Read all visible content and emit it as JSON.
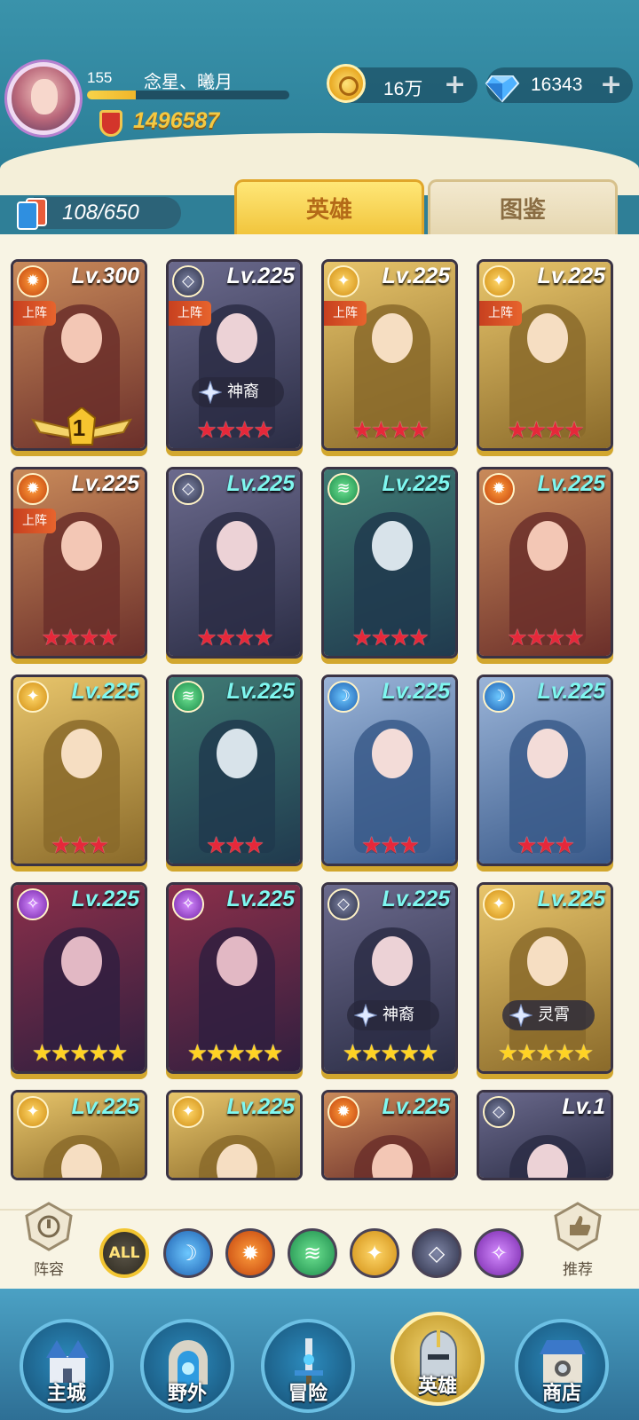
{
  "player": {
    "level": "155",
    "name": "念星、曦月",
    "power": "1496587",
    "exp_fraction": 0.24
  },
  "resources": {
    "gold": "16万",
    "gems": "16343"
  },
  "collection": {
    "count": "108/650"
  },
  "tabs": [
    {
      "label": "英雄",
      "active": true
    },
    {
      "label": "图鉴",
      "active": false
    }
  ],
  "deployed_label": "上阵",
  "heroes": [
    {
      "level": "Lv.300",
      "faction": "fire",
      "deployed": true,
      "stars": 0,
      "star_color": "red",
      "rank": "1"
    },
    {
      "level": "Lv.225",
      "faction": "void",
      "deployed": true,
      "stars": 4,
      "star_color": "red",
      "tag": "神裔"
    },
    {
      "level": "Lv.225",
      "faction": "light",
      "deployed": true,
      "stars": 4,
      "star_color": "red"
    },
    {
      "level": "Lv.225",
      "faction": "light",
      "deployed": true,
      "stars": 4,
      "star_color": "red"
    },
    {
      "level": "Lv.225",
      "faction": "fire",
      "deployed": true,
      "stars": 4,
      "star_color": "red"
    },
    {
      "level": "Lv.225",
      "faction": "void",
      "deployed": false,
      "stars": 4,
      "star_color": "red"
    },
    {
      "level": "Lv.225",
      "faction": "wind",
      "deployed": false,
      "stars": 4,
      "star_color": "red"
    },
    {
      "level": "Lv.225",
      "faction": "fire",
      "deployed": false,
      "stars": 4,
      "star_color": "red"
    },
    {
      "level": "Lv.225",
      "faction": "light",
      "deployed": false,
      "stars": 3,
      "star_color": "red"
    },
    {
      "level": "Lv.225",
      "faction": "wind",
      "deployed": false,
      "stars": 3,
      "star_color": "red"
    },
    {
      "level": "Lv.225",
      "faction": "water",
      "deployed": false,
      "stars": 3,
      "star_color": "red"
    },
    {
      "level": "Lv.225",
      "faction": "water",
      "deployed": false,
      "stars": 3,
      "star_color": "red"
    },
    {
      "level": "Lv.225",
      "faction": "arcane",
      "deployed": false,
      "stars": 5,
      "star_color": "gold"
    },
    {
      "level": "Lv.225",
      "faction": "arcane",
      "deployed": false,
      "stars": 5,
      "star_color": "gold"
    },
    {
      "level": "Lv.225",
      "faction": "void",
      "deployed": false,
      "stars": 5,
      "star_color": "gold",
      "tag": "神裔"
    },
    {
      "level": "Lv.225",
      "faction": "light",
      "deployed": false,
      "stars": 5,
      "star_color": "gold",
      "tag": "灵霄"
    },
    {
      "level": "Lv.225",
      "faction": "light",
      "deployed": false,
      "stars": 0,
      "star_color": "gold"
    },
    {
      "level": "Lv.225",
      "faction": "light",
      "deployed": false,
      "stars": 0,
      "star_color": "gold"
    },
    {
      "level": "Lv.225",
      "faction": "fire",
      "deployed": false,
      "stars": 0,
      "star_color": "gold"
    },
    {
      "level": "Lv.1",
      "faction": "void",
      "deployed": false,
      "stars": 0,
      "star_color": "gold"
    }
  ],
  "filter": {
    "lineup_label": "阵容",
    "recommend_label": "推荐",
    "all_label": "ALL",
    "elements": [
      "water",
      "fire",
      "wind",
      "light",
      "void",
      "arcane"
    ]
  },
  "nav": [
    {
      "label": "主城",
      "icon": "castle-icon"
    },
    {
      "label": "野外",
      "icon": "portal-icon"
    },
    {
      "label": "冒险",
      "icon": "sword-icon"
    },
    {
      "label": "英雄",
      "icon": "helmet-icon",
      "active": true
    },
    {
      "label": "商店",
      "icon": "shop-icon"
    }
  ]
}
